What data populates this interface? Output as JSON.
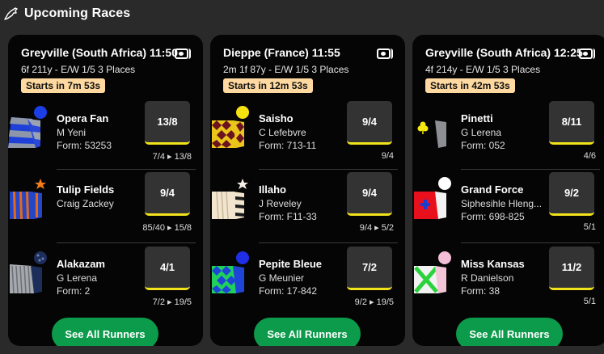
{
  "header": {
    "title": "Upcoming Races"
  },
  "races": [
    {
      "title": "Greyville (South Africa) 11:50",
      "info": "6f 211y - E/W 1/5 3 Places",
      "starts": "Starts in 7m 53s",
      "see_all": "See All Runners",
      "runners": [
        {
          "name": "Opera Fan",
          "jockey": "M Yeni",
          "form": "Form: 53253",
          "odds": "13/8",
          "history": "7/4 ▸ 13/8",
          "silk": "blue-grey-hoops"
        },
        {
          "name": "Tulip Fields",
          "jockey": "Craig Zackey",
          "form": "",
          "odds": "9/4",
          "history": "85/40 ▸ 15/8",
          "silk": "orange-blue-stripes"
        },
        {
          "name": "Alakazam",
          "jockey": "G Lerena",
          "form": "Form: 2",
          "odds": "4/1",
          "history": "7/2 ▸ 19/5",
          "silk": "grey-navy"
        }
      ]
    },
    {
      "title": "Dieppe (France) 11:55",
      "info": "2m 1f 87y - E/W 1/5 3 Places",
      "starts": "Starts in 12m 53s",
      "see_all": "See All Runners",
      "runners": [
        {
          "name": "Saisho",
          "jockey": "C Lefebvre",
          "form": "Form: 713-11",
          "odds": "9/4",
          "history": "9/4",
          "silk": "maroon-yellow-diamonds"
        },
        {
          "name": "Illaho",
          "jockey": "J Reveley",
          "form": "Form: F11-33",
          "odds": "9/4",
          "history": "9/4 ▸ 5/2",
          "silk": "cream-black"
        },
        {
          "name": "Pepite Bleue",
          "jockey": "G Meunier",
          "form": "Form: 17-842",
          "odds": "7/2",
          "history": "9/2 ▸ 19/5",
          "silk": "blue-green-check"
        }
      ]
    },
    {
      "title": "Greyville (South Africa) 12:25",
      "info": "4f 214y - E/W 1/5 3 Places",
      "starts": "Starts in 42m 53s",
      "see_all": "See All Runners",
      "runners": [
        {
          "name": "Pinetti",
          "jockey": "G Lerena",
          "form": "Form: 052",
          "odds": "8/11",
          "history": "4/6",
          "silk": "black-yellow-clover"
        },
        {
          "name": "Grand Force",
          "jockey": "Siphesihle Hleng...",
          "form": "Form: 698-825",
          "odds": "9/2",
          "history": "5/1",
          "silk": "red-white"
        },
        {
          "name": "Miss Kansas",
          "jockey": "R Danielson",
          "form": "Form: 38",
          "odds": "11/2",
          "history": "5/1",
          "silk": "white-green-cross"
        }
      ]
    }
  ],
  "colors": {
    "see_all_bg": "#0c9a4b",
    "starts_bg": "#ffd9a0",
    "odds_bar": "#f2e21b"
  }
}
